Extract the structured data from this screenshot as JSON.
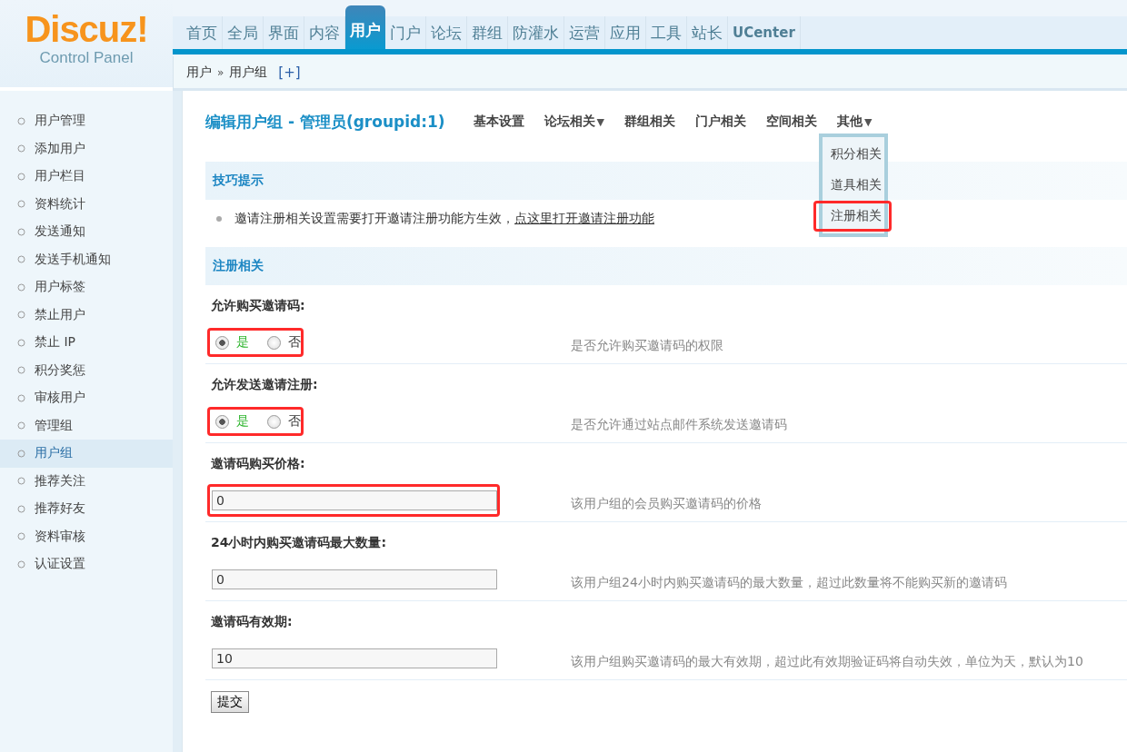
{
  "logo": {
    "title": "Discuz!",
    "subtitle": "Control Panel"
  },
  "top_nav": [
    {
      "label": "首页",
      "selected": false
    },
    {
      "label": "全局",
      "selected": false
    },
    {
      "label": "界面",
      "selected": false
    },
    {
      "label": "内容",
      "selected": false
    },
    {
      "label": "用户",
      "selected": true
    },
    {
      "label": "门户",
      "selected": false
    },
    {
      "label": "论坛",
      "selected": false
    },
    {
      "label": "群组",
      "selected": false
    },
    {
      "label": "防灌水",
      "selected": false
    },
    {
      "label": "运营",
      "selected": false
    },
    {
      "label": "应用",
      "selected": false
    },
    {
      "label": "工具",
      "selected": false
    },
    {
      "label": "站长",
      "selected": false
    },
    {
      "label": "UCenter",
      "selected": false
    }
  ],
  "breadcrumb": {
    "items": [
      "用户",
      "用户组"
    ],
    "separator": "»",
    "add": "[+]"
  },
  "sidebar": {
    "items": [
      {
        "label": "用户管理",
        "selected": false
      },
      {
        "label": "添加用户",
        "selected": false
      },
      {
        "label": "用户栏目",
        "selected": false
      },
      {
        "label": "资料统计",
        "selected": false
      },
      {
        "label": "发送通知",
        "selected": false
      },
      {
        "label": "发送手机通知",
        "selected": false
      },
      {
        "label": "用户标签",
        "selected": false
      },
      {
        "label": "禁止用户",
        "selected": false
      },
      {
        "label": "禁止 IP",
        "selected": false
      },
      {
        "label": "积分奖惩",
        "selected": false
      },
      {
        "label": "审核用户",
        "selected": false
      },
      {
        "label": "管理组",
        "selected": false
      },
      {
        "label": "用户组",
        "selected": true
      },
      {
        "label": "推荐关注",
        "selected": false
      },
      {
        "label": "推荐好友",
        "selected": false
      },
      {
        "label": "资料审核",
        "selected": false
      },
      {
        "label": "认证设置",
        "selected": false
      }
    ]
  },
  "page_title": "编辑用户组 - 管理员(groupid:1)",
  "sub_tabs": [
    {
      "label": "基本设置"
    },
    {
      "label": "论坛相关",
      "caret": "▼"
    },
    {
      "label": "群组相关"
    },
    {
      "label": "门户相关"
    },
    {
      "label": "空间相关"
    },
    {
      "label": "其他",
      "caret": "▼"
    }
  ],
  "dropdown": {
    "items": [
      {
        "label": "积分相关",
        "highlighted": false
      },
      {
        "label": "道具相关",
        "highlighted": false
      },
      {
        "label": "注册相关",
        "highlighted": true
      }
    ]
  },
  "tips": {
    "title": "技巧提示",
    "text": "邀请注册相关设置需要打开邀请注册功能方生效，",
    "link": "点这里打开邀请注册功能"
  },
  "section_title": "注册相关",
  "fields": [
    {
      "kind": "radio",
      "label": "允许购买邀请码:",
      "options": [
        {
          "label": "是",
          "selected": true
        },
        {
          "label": "否",
          "selected": false
        }
      ],
      "description": "是否允许购买邀请码的权限",
      "highlighted": true
    },
    {
      "kind": "radio",
      "label": "允许发送邀请注册:",
      "options": [
        {
          "label": "是",
          "selected": true
        },
        {
          "label": "否",
          "selected": false
        }
      ],
      "description": "是否允许通过站点邮件系统发送邀请码",
      "highlighted": true
    },
    {
      "kind": "text",
      "label": "邀请码购买价格:",
      "value": "0",
      "description": "该用户组的会员购买邀请码的价格",
      "highlighted": true
    },
    {
      "kind": "text",
      "label": "24小时内购买邀请码最大数量:",
      "value": "0",
      "description": "该用户组24小时内购买邀请码的最大数量，超过此数量将不能购买新的邀请码",
      "highlighted": false
    },
    {
      "kind": "text",
      "label": "邀请码有效期:",
      "value": "10",
      "description": "该用户组购买邀请码的最大有效期，超过此有效期验证码将自动失效，单位为天，默认为10",
      "highlighted": false
    }
  ],
  "submit": "提交"
}
